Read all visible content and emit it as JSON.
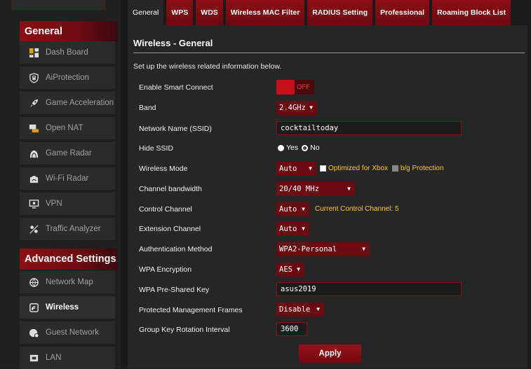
{
  "sidebar": {
    "general_heading": "General",
    "advanced_heading": "Advanced Settings",
    "items": [
      {
        "label": "Dash Board",
        "icon": "dashboard-icon"
      },
      {
        "label": "AiProtection",
        "icon": "aiprotection-lock-icon"
      },
      {
        "label": "Game Acceleration",
        "icon": "rocket-icon"
      },
      {
        "label": "Open NAT",
        "icon": "open-nat-icon"
      },
      {
        "label": "Game Radar",
        "icon": "game-radar-icon"
      },
      {
        "label": "Wi-Fi Radar",
        "icon": "wifi-radar-icon"
      },
      {
        "label": "VPN",
        "icon": "vpn-monitor-icon"
      },
      {
        "label": "Traffic Analyzer",
        "icon": "traffic-analyzer-icon"
      }
    ],
    "advanced_items": [
      {
        "label": "Network Map",
        "icon": "network-map-icon"
      },
      {
        "label": "Wireless",
        "icon": "wireless-icon",
        "active": true
      },
      {
        "label": "Guest Network",
        "icon": "guest-network-icon"
      },
      {
        "label": "LAN",
        "icon": "lan-icon"
      }
    ]
  },
  "tabs": [
    "General",
    "WPS",
    "WDS",
    "Wireless MAC Filter",
    "RADIUS Setting",
    "Professional",
    "Roaming Block List"
  ],
  "page": {
    "title": "Wireless - General",
    "description": "Set up the wireless related information below."
  },
  "form": {
    "smart_connect": {
      "label": "Enable Smart Connect",
      "state": "OFF"
    },
    "band": {
      "label": "Band",
      "value": "2.4GHz"
    },
    "ssid": {
      "label": "Network Name (SSID)",
      "value": "cocktailtoday"
    },
    "hide_ssid": {
      "label": "Hide SSID",
      "yes": "Yes",
      "no": "No",
      "selected": "No"
    },
    "wireless_mode": {
      "label": "Wireless Mode",
      "value": "Auto",
      "opt_xbox": "Optimized for Xbox",
      "opt_bg": "b/g Protection"
    },
    "channel_bandwidth": {
      "label": "Channel bandwidth",
      "value": "20/40 MHz"
    },
    "control_channel": {
      "label": "Control Channel",
      "value": "Auto",
      "note": "Current Control Channel: 5"
    },
    "extension_channel": {
      "label": "Extension Channel",
      "value": "Auto"
    },
    "auth_method": {
      "label": "Authentication Method",
      "value": "WPA2-Personal"
    },
    "wpa_encryption": {
      "label": "WPA Encryption",
      "value": "AES"
    },
    "psk": {
      "label": "WPA Pre-Shared Key",
      "value": "asus2019"
    },
    "pmf": {
      "label": "Protected Management Frames",
      "value": "Disable"
    },
    "group_key": {
      "label": "Group Key Rotation Interval",
      "value": "3600"
    }
  },
  "apply_label": "Apply",
  "colors": {
    "accent": "#8a0f16",
    "note": "#ffcc00",
    "toggle_off_text": "#ff3a3a"
  }
}
